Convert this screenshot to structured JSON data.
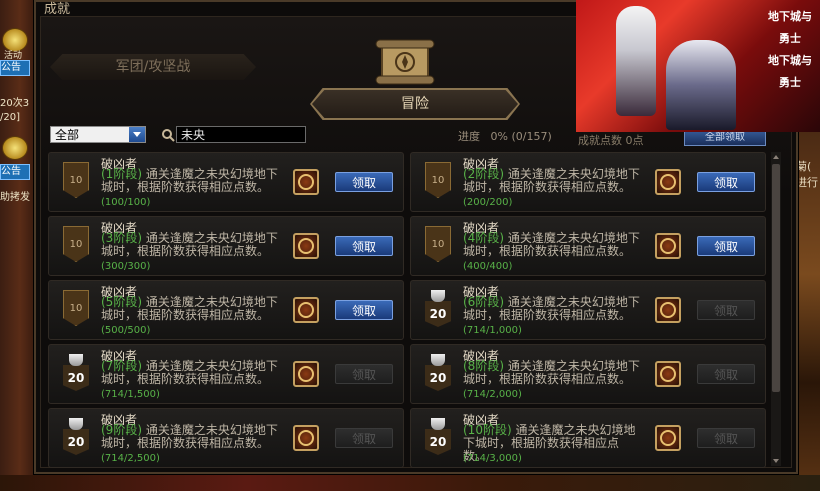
{
  "window": {
    "title": "成就",
    "tabs": [
      {
        "label": "军团/攻坚战",
        "active": false
      },
      {
        "label": "冒险",
        "active": true
      }
    ]
  },
  "toolbar": {
    "filter_value": "全部",
    "search_value": "未央",
    "progress_label": "进度",
    "progress_value": "0%",
    "progress_count": "(0/157)",
    "points_label": "成就点数",
    "points_value": "0点",
    "claim_all_label": "全部领取"
  },
  "achievements": [
    {
      "title": "破凶者",
      "stage": "(1阶段)",
      "desc": " 通关逢魔之未央幻境地下城时，根据阶数获得相应点数。",
      "count": "(100/100)",
      "badge": "10",
      "badge_type": "medal",
      "claim": "领取",
      "claimable": true
    },
    {
      "title": "破凶者",
      "stage": "(2阶段)",
      "desc": " 通关逢魔之未央幻境地下城时，根据阶数获得相应点数。",
      "count": "(200/200)",
      "badge": "10",
      "badge_type": "medal",
      "claim": "领取",
      "claimable": true
    },
    {
      "title": "破凶者",
      "stage": "(3阶段)",
      "desc": " 通关逢魔之未央幻境地下城时，根据阶数获得相应点数。",
      "count": "(300/300)",
      "badge": "10",
      "badge_type": "medal",
      "claim": "领取",
      "claimable": true
    },
    {
      "title": "破凶者",
      "stage": "(4阶段)",
      "desc": " 通关逢魔之未央幻境地下城时，根据阶数获得相应点数。",
      "count": "(400/400)",
      "badge": "10",
      "badge_type": "medal",
      "claim": "领取",
      "claimable": true
    },
    {
      "title": "破凶者",
      "stage": "(5阶段)",
      "desc": " 通关逢魔之未央幻境地下城时，根据阶数获得相应点数。",
      "count": "(500/500)",
      "badge": "10",
      "badge_type": "medal",
      "claim": "领取",
      "claimable": true
    },
    {
      "title": "破凶者",
      "stage": "(6阶段)",
      "desc": " 通关逢魔之未央幻境地下城时，根据阶数获得相应点数。",
      "count": "(714/1,000)",
      "badge": "20",
      "badge_type": "cup",
      "claim": "领取",
      "claimable": false
    },
    {
      "title": "破凶者",
      "stage": "(7阶段)",
      "desc": " 通关逢魔之未央幻境地下城时，根据阶数获得相应点数。",
      "count": "(714/1,500)",
      "badge": "20",
      "badge_type": "cup",
      "claim": "领取",
      "claimable": false
    },
    {
      "title": "破凶者",
      "stage": "(8阶段)",
      "desc": " 通关逢魔之未央幻境地下城时，根据阶数获得相应点数。",
      "count": "(714/2,000)",
      "badge": "20",
      "badge_type": "cup",
      "claim": "领取",
      "claimable": false
    },
    {
      "title": "破凶者",
      "stage": "(9阶段)",
      "desc": " 通关逢魔之未央幻境地下城时，根据阶数获得相应点数。",
      "count": "(714/2,500)",
      "badge": "20",
      "badge_type": "cup",
      "claim": "领取",
      "claimable": false
    },
    {
      "title": "破凶者",
      "stage": "(10阶段)",
      "desc": " 通关逢魔之未央幻境地下城时，根据阶数获得相应点数。",
      "count": "(714/3,000)",
      "badge": "20",
      "badge_type": "cup",
      "claim": "领取",
      "claimable": false
    }
  ],
  "left_strip": {
    "badge_label": "活动",
    "btn_label": "公告",
    "line1": "20次3",
    "line2": "/20]",
    "line3": "助拷发"
  },
  "right_strip": {
    "line1": "菊(",
    "line2": "进行"
  },
  "ad": {
    "logo_line1": "地下城与勇士",
    "logo_line2": "地下城与勇士"
  },
  "colors": {
    "accent_blue": "#1a3a7a",
    "stage_green": "#58b248",
    "frame_gold": "#8a7450"
  }
}
